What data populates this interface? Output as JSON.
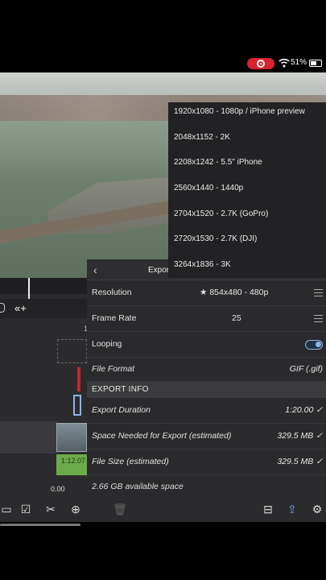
{
  "status_bar": {
    "battery_percent": "51%"
  },
  "export_panel": {
    "title": "Expor",
    "resolution": {
      "label": "Resolution",
      "value": "★ 854x480 - 480p"
    },
    "frame_rate": {
      "label": "Frame Rate",
      "value": "25"
    },
    "looping": {
      "label": "Looping",
      "on": true
    },
    "file_format": {
      "label": "File Format",
      "value": "GIF (.gif)"
    },
    "section_title": "EXPORT INFO",
    "export_duration": {
      "label": "Export Duration",
      "value": "1:20.00 ✓"
    },
    "space_needed": {
      "label": "Space Needed for Export (estimated)",
      "value": "329.5 MB ✓"
    },
    "file_size": {
      "label": "File Size (estimated)",
      "value": "329.5 MB ✓"
    },
    "available_space": "2.66 GB available space"
  },
  "resolution_options": [
    "1920x1080 - 1080p / iPhone preview",
    "2048x1152 - 2K",
    "2208x1242 - 5.5\" iPhone",
    "2560x1440 - 1440p",
    "2704x1520 - 2.7K (GoPro)",
    "2720x1530 - 2.7K (DJI)",
    "3264x1836 - 3K"
  ],
  "timeline": {
    "tick_label": "1",
    "clip_time": "1:12.07",
    "time_readout": "0.00"
  },
  "colors": {
    "record": "#d9232f",
    "toggle": "#8fb3e6",
    "audio_clip": "#6cab4a"
  }
}
